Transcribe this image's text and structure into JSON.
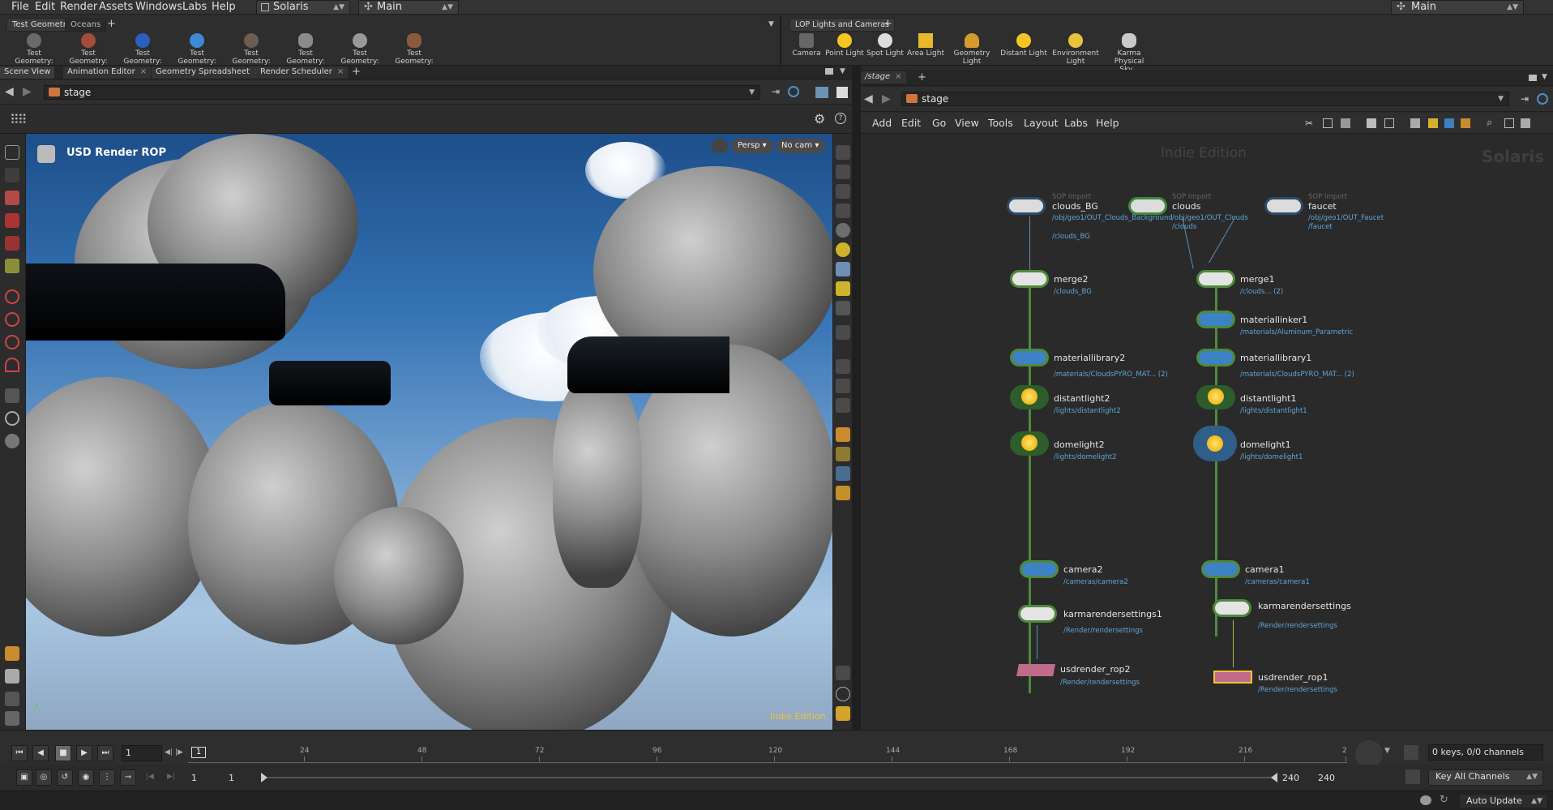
{
  "menubar": {
    "items": [
      "File",
      "Edit",
      "Render",
      "Assets",
      "Windows",
      "Labs",
      "Help"
    ],
    "desktop": "Solaris",
    "context": "Main",
    "right_desktop": "Main"
  },
  "shelf_left": {
    "tabs": [
      "Test Geometry",
      "Oceans"
    ],
    "tools": [
      "Test Geometry: C...",
      "Test Geometry: P...",
      "Test Geometry: R...",
      "Test Geometry: S...",
      "Test Geometry: S...",
      "Test Geometry: T...",
      "Test Geometry: T...",
      "Test Geometry: T..."
    ]
  },
  "shelf_right": {
    "tab": "LOP Lights and Cameras",
    "tools": [
      "Camera",
      "Point Light",
      "Spot Light",
      "Area Light",
      "Geometry Light",
      "Distant Light",
      "Environment Light",
      "Karma Physical Sky..."
    ]
  },
  "left_pane": {
    "tabs": [
      "Scene View",
      "Animation Editor",
      "Geometry Spreadsheet",
      "Render Scheduler"
    ],
    "path": "stage"
  },
  "viewport": {
    "title": "USD Render ROP",
    "persp": "Persp",
    "cam": "No cam",
    "watermark": "Indie Edition"
  },
  "right_pane": {
    "tab": "/stage",
    "path": "stage",
    "menu": [
      "Add",
      "Edit",
      "Go",
      "View",
      "Tools",
      "Layout",
      "Labs",
      "Help"
    ],
    "watermark_center": "Indie Edition",
    "watermark_right": "Solaris"
  },
  "nodes": {
    "clouds_bg": {
      "type": "SOP Import",
      "name": "clouds_BG",
      "path1": "/obj/geo1/OUT_Clouds_Background",
      "path2": "/clouds_BG"
    },
    "clouds": {
      "type": "SOP Import",
      "name": "clouds",
      "path1": "/obj/geo1/OUT_Clouds",
      "path2": "/clouds"
    },
    "faucet": {
      "type": "SOP Import",
      "name": "faucet",
      "path1": "/obj/geo1/OUT_Faucet",
      "path2": "/faucet"
    },
    "merge2": {
      "name": "merge2",
      "path": "/clouds_BG"
    },
    "merge1": {
      "name": "merge1",
      "path": "/clouds... (2)"
    },
    "materiallinker1": {
      "name": "materiallinker1",
      "path": "/materials/Aluminum_Parametric"
    },
    "materiallibrary2": {
      "name": "materiallibrary2",
      "path": "/materials/CloudsPYRO_MAT... (2)"
    },
    "materiallibrary1": {
      "name": "materiallibrary1",
      "path": "/materials/CloudsPYRO_MAT... (2)"
    },
    "distantlight2": {
      "name": "distantlight2",
      "path": "/lights/distantlight2"
    },
    "distantlight1": {
      "name": "distantlight1",
      "path": "/lights/distantlight1"
    },
    "domelight2": {
      "name": "domelight2",
      "path": "/lights/domelight2"
    },
    "domelight1": {
      "name": "domelight1",
      "path": "/lights/domelight1"
    },
    "camera2": {
      "name": "camera2",
      "path": "/cameras/camera2"
    },
    "camera1": {
      "name": "camera1",
      "path": "/cameras/camera1"
    },
    "karma1": {
      "name": "karmarendersettings1",
      "path": "/Render/rendersettings"
    },
    "karma": {
      "name": "karmarendersettings",
      "path": "/Render/rendersettings"
    },
    "rop2": {
      "name": "usdrender_rop2",
      "path": "/Render/rendersettings"
    },
    "rop1": {
      "name": "usdrender_rop1",
      "path": "/Render/rendersettings"
    }
  },
  "timeline": {
    "current_frame": "1",
    "frame_marker": "1",
    "ticks": [
      "24",
      "48",
      "72",
      "96",
      "120",
      "144",
      "168",
      "192",
      "216",
      "2"
    ],
    "keys_info": "0 keys, 0/0 channels",
    "key_channels": "Key All Channels",
    "range_start": "1",
    "range_start2": "1",
    "range_end": "240",
    "range_end2": "240"
  },
  "status": {
    "auto_update": "Auto Update"
  }
}
